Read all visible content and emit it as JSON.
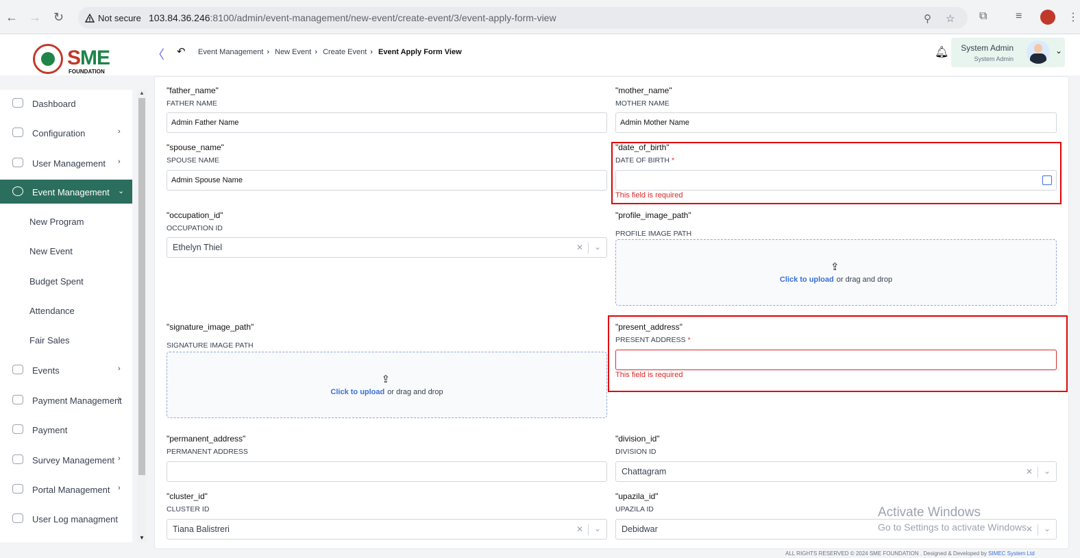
{
  "browser": {
    "security_label": "Not secure",
    "url_host": "103.84.36.246",
    "url_rest": ":8100/admin/event-management/new-event/create-event/3/event-apply-form-view"
  },
  "logo": {
    "brand_s": "S",
    "brand_rest": "ME",
    "foundation": "FOUNDATION"
  },
  "breadcrumb": {
    "items": [
      "Event Management",
      "New Event",
      "Create Event"
    ],
    "current": "Event Apply Form View"
  },
  "user": {
    "name": "System Admin",
    "role": "System Admin"
  },
  "sidebar": {
    "items": [
      {
        "label": "Dashboard"
      },
      {
        "label": "Configuration"
      },
      {
        "label": "User Management"
      },
      {
        "label": "Event Management"
      },
      {
        "label": "Events"
      },
      {
        "label": "Payment Management"
      },
      {
        "label": "Payment"
      },
      {
        "label": "Survey Management"
      },
      {
        "label": "Portal Management"
      },
      {
        "label": "User Log managment"
      }
    ],
    "sub_items": [
      "New Program",
      "New Event",
      "Budget Spent",
      "Attendance",
      "Fair Sales"
    ]
  },
  "form": {
    "father": {
      "key": "\"father_name\"",
      "label": "FATHER NAME",
      "value": "Admin Father Name"
    },
    "mother": {
      "key": "\"mother_name\"",
      "label": "MOTHER NAME",
      "value": "Admin Mother Name"
    },
    "spouse": {
      "key": "\"spouse_name\"",
      "label": "SPOUSE NAME",
      "value": "Admin Spouse Name"
    },
    "dob": {
      "key": "\"date_of_birth\"",
      "label": "DATE OF BIRTH",
      "required": "*",
      "value": "",
      "error": "This field is required"
    },
    "occupation": {
      "key": "\"occupation_id\"",
      "label": "OCCUPATION ID",
      "value": "Ethelyn Thiel"
    },
    "profile_image": {
      "key": "\"profile_image_path\"",
      "label": "PROFILE IMAGE PATH",
      "upload_link": "Click to upload",
      "upload_rest": "or drag and drop"
    },
    "signature_image": {
      "key": "\"signature_image_path\"",
      "label": "SIGNATURE IMAGE PATH",
      "upload_link": "Click to upload",
      "upload_rest": "or drag and drop"
    },
    "present_address": {
      "key": "\"present_address\"",
      "label": "PRESENT ADDRESS",
      "required": "*",
      "value": "",
      "error": "This field is required"
    },
    "permanent_address": {
      "key": "\"permanent_address\"",
      "label": "PERMANENT ADDRESS",
      "value": ""
    },
    "division": {
      "key": "\"division_id\"",
      "label": "DIVISION ID",
      "value": "Chattagram"
    },
    "cluster": {
      "key": "\"cluster_id\"",
      "label": "CLUSTER ID",
      "value": "Tiana Balistreri"
    },
    "upazila": {
      "key": "\"upazila_id\"",
      "label": "UPAZILA ID",
      "value": "Debidwar"
    }
  },
  "watermark": {
    "title": "Activate Windows",
    "subtitle": "Go to Settings to activate Windows."
  },
  "footer": {
    "text": "ALL RIGHTS RESERVED © 2024 SME FOUNDATION . Designed & Developed by",
    "link": "SIMEC System Ltd"
  }
}
